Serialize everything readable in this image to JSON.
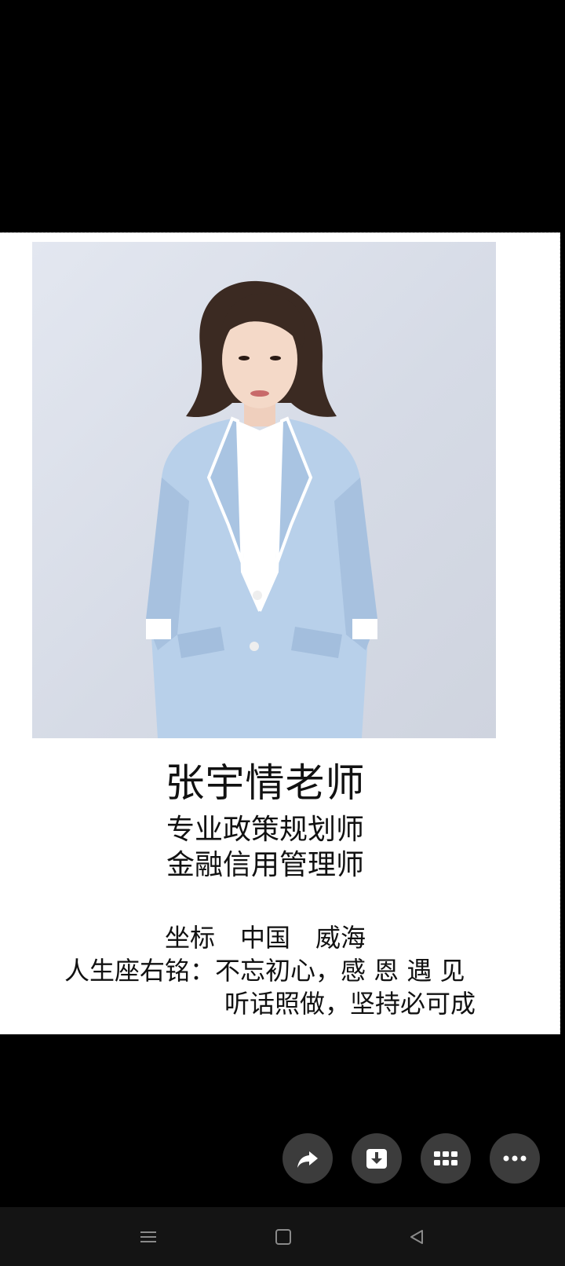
{
  "profile": {
    "name": "张宇情老师",
    "title_1": "专业政策规划师",
    "title_2": "金融信用管理师",
    "location": "坐标　中国　威海",
    "motto_line_1": "人生座右铭：不忘初心，感 恩 遇 见",
    "motto_line_2": "听话照做，坚持必可成"
  },
  "actions": {
    "share_icon": "share-icon",
    "download_icon": "download-icon",
    "grid_icon": "grid-icon",
    "more_icon": "more-icon"
  },
  "navigation": {
    "menu_icon": "menu-icon",
    "home_icon": "home-icon",
    "back_icon": "back-icon"
  },
  "colors": {
    "background": "#000000",
    "card": "#ffffff",
    "button": "#3c3c3c",
    "navbar": "#141414",
    "suit": "#b8d0ea"
  }
}
